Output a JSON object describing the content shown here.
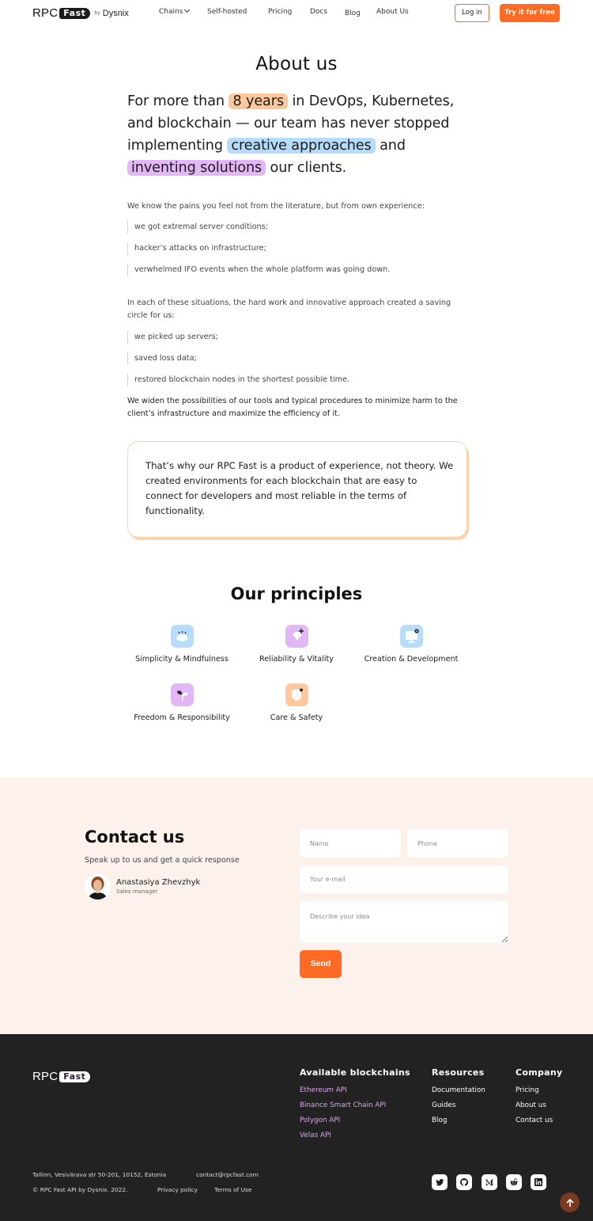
{
  "nav": {
    "logo": {
      "rpc": "RPC",
      "fast": "Fast",
      "by": "by",
      "company": "Dysnix"
    },
    "links": [
      "Chains",
      "Self-hosted",
      "Pricing",
      "Docs",
      "Blog",
      "About Us"
    ],
    "login_label": "Log in",
    "try_label": "Try it for free"
  },
  "about": {
    "title": "About us",
    "lead": {
      "part1": "For more than ",
      "hl1": "8 years",
      "part2": " in DevOps, Kubernetes, and blockchain — our team has never stopped implementing ",
      "hl2": "creative approaches",
      "part3": " and ",
      "hl3": "inventing solutions",
      "part4": " our clients."
    },
    "pains_intro": "We know the pains you feel not from the literature, but from own experience:",
    "pains": [
      "we got extremal server conditions;",
      "hacker’s attacks on infrastructure;",
      "verwhelmed IFO events when the whole platform was going down."
    ],
    "saving_intro": "In each of these situations, the hard work and innovative approach created a saving circle for us:",
    "savings": [
      "we picked up servers;",
      "saved loss data;",
      "restored blockchain nodes in the shortest possible time."
    ],
    "widen": "We widen the possibilities of our tools and typical procedures to minimize harm to the client’s infrastructure and maximize the efficiency of it.",
    "quote": "That’s why our RPC Fast is a product of experience, not theory. We created environments for each blockchain that are easy to connect for developers and most reliable in the terms of functionality."
  },
  "principles": {
    "title": "Our principles",
    "items": [
      {
        "label": "Simplicity & Mindfulness",
        "icon": "eye-icon",
        "color": "#b7dcfa"
      },
      {
        "label": "Reliability & Vitality",
        "icon": "diamond-icon",
        "color": "#e2b7f5"
      },
      {
        "label": "Creation & Development",
        "icon": "monitor-icon",
        "color": "#b7dcfa"
      },
      {
        "label": "Freedom & Responsibility",
        "icon": "sprout-icon",
        "color": "#e2b7f5"
      },
      {
        "label": "Care & Safety",
        "icon": "shield-heart-icon",
        "color": "#ffc89c"
      }
    ]
  },
  "contact": {
    "title": "Contact us",
    "subtitle": "Speak up to us and get a quick response",
    "person_name": "Anastasiya Zhevzhyk",
    "person_role": "Sales manager",
    "name_placeholder": "Name",
    "phone_placeholder": "Phone",
    "email_placeholder": "Your e-mail",
    "idea_placeholder": "Describe your idea",
    "send_label": "Send"
  },
  "footer": {
    "logo": {
      "rpc": "RPC",
      "fast": "Fast"
    },
    "blockchains_title": "Available blockchains",
    "blockchains": [
      "Ethereum API",
      "Binance Smart Chain API",
      "Polygon API",
      "Velas API"
    ],
    "resources_title": "Resources",
    "resources": [
      "Documentation",
      "Guides",
      "Blog"
    ],
    "company_title": "Company",
    "company": [
      "Pricing",
      "About us",
      "Contact us"
    ],
    "address": "Tallinn, Vesivärava str 50-201, 10152, Estonia",
    "email": "contact@rpcfast.com",
    "copyright": "© RPC Fast API by Dysnix. 2022.",
    "privacy": "Privacy policy",
    "terms": "Terms of Use",
    "socials": [
      "twitter-icon",
      "github-icon",
      "medium-icon",
      "reddit-icon",
      "linkedin-icon"
    ]
  },
  "colors": {
    "accent": "#ff6b24",
    "highlight_orange": "#ffc89c",
    "highlight_blue": "#b7dcfa",
    "highlight_purple": "#e2b7f5",
    "contact_bg": "#fdf1ec",
    "footer_bg": "#222222",
    "footer_link_purple": "#d8a6f0"
  }
}
